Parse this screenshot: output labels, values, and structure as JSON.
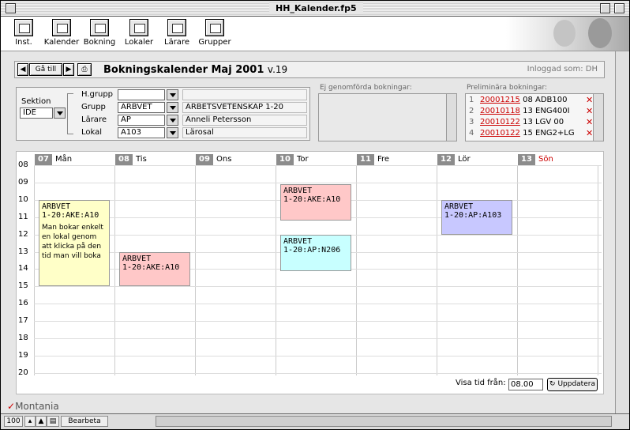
{
  "window": {
    "title": "HH_Kalender.fp5"
  },
  "toolbar": {
    "items": [
      {
        "label": "Inst.",
        "icon": "settings-icon"
      },
      {
        "label": "Kalender",
        "icon": "calendar-icon"
      },
      {
        "label": "Bokning",
        "icon": "booking-icon"
      },
      {
        "label": "Lokaler",
        "icon": "rooms-icon"
      },
      {
        "label": "Lärare",
        "icon": "teacher-icon"
      },
      {
        "label": "Grupper",
        "icon": "groups-icon"
      }
    ]
  },
  "nav": {
    "goto_label": "Gå till",
    "title": "Bokningskalender Maj 2001",
    "version": "v.19",
    "logged_in": "Inloggad som: DH"
  },
  "selection": {
    "sektion_label": "Sektion",
    "sektion_value": "IDE",
    "hgrupp_label": "H.grupp",
    "hgrupp_value": "",
    "hgrupp_info": "",
    "grupp_label": "Grupp",
    "grupp_value": "ARBVET",
    "grupp_info": "ARBETSVETENSKAP 1-20",
    "larare_label": "Lärare",
    "larare_value": "AP",
    "larare_info": "Anneli Petersson",
    "lokal_label": "Lokal",
    "lokal_value": "A103",
    "lokal_info": "Lärosal"
  },
  "unperformed": {
    "label": "Ej genomförda bokningar:"
  },
  "preliminary": {
    "label": "Preliminära bokningar:",
    "rows": [
      {
        "num": "1",
        "date": "20001215",
        "time": "08",
        "code": "ADB100"
      },
      {
        "num": "2",
        "date": "20010118",
        "time": "13",
        "code": "ENG400I"
      },
      {
        "num": "3",
        "date": "20010122",
        "time": "13",
        "code": "LGV 00"
      },
      {
        "num": "4",
        "date": "20010122",
        "time": "15",
        "code": "ENG2+LG"
      }
    ]
  },
  "calendar": {
    "days": [
      {
        "num": "07",
        "name": "Mån"
      },
      {
        "num": "08",
        "name": "Tis"
      },
      {
        "num": "09",
        "name": "Ons"
      },
      {
        "num": "10",
        "name": "Tor"
      },
      {
        "num": "11",
        "name": "Fre"
      },
      {
        "num": "12",
        "name": "Lör"
      },
      {
        "num": "13",
        "name": "Sön"
      }
    ],
    "hours": [
      "08",
      "09",
      "10",
      "11",
      "12",
      "13",
      "14",
      "15",
      "16",
      "17",
      "18",
      "19",
      "20"
    ],
    "events": [
      {
        "day": 0,
        "start": 10,
        "end": 15,
        "color": "#ffffc8",
        "text": "ARBVET\n1-20:AKE:A10",
        "note": "Man bokar enkelt en lokal genom att klicka på den tid man vill boka"
      },
      {
        "day": 1,
        "start": 13,
        "end": 15,
        "color": "#ffc8c8",
        "text": "ARBVET\n1-20:AKE:A10"
      },
      {
        "day": 3,
        "start": 9.1,
        "end": 11.2,
        "color": "#ffc8c8",
        "text": "ARBVET\n1-20:AKE:A10"
      },
      {
        "day": 3,
        "start": 12,
        "end": 14.1,
        "color": "#c8ffff",
        "text": "ARBVET\n1-20:AP:N206"
      },
      {
        "day": 5,
        "start": 10,
        "end": 12,
        "color": "#c8c8ff",
        "text": "ARBVET\n1-20:AP:A103"
      }
    ],
    "sunday_color": "#cc0000"
  },
  "footer": {
    "visa_label": "Visa tid från:",
    "visa_value": "08.00",
    "update_label": "Uppdatera",
    "logo": "Montania"
  },
  "statusbar": {
    "zoom": "100",
    "mode": "Bearbeta"
  }
}
